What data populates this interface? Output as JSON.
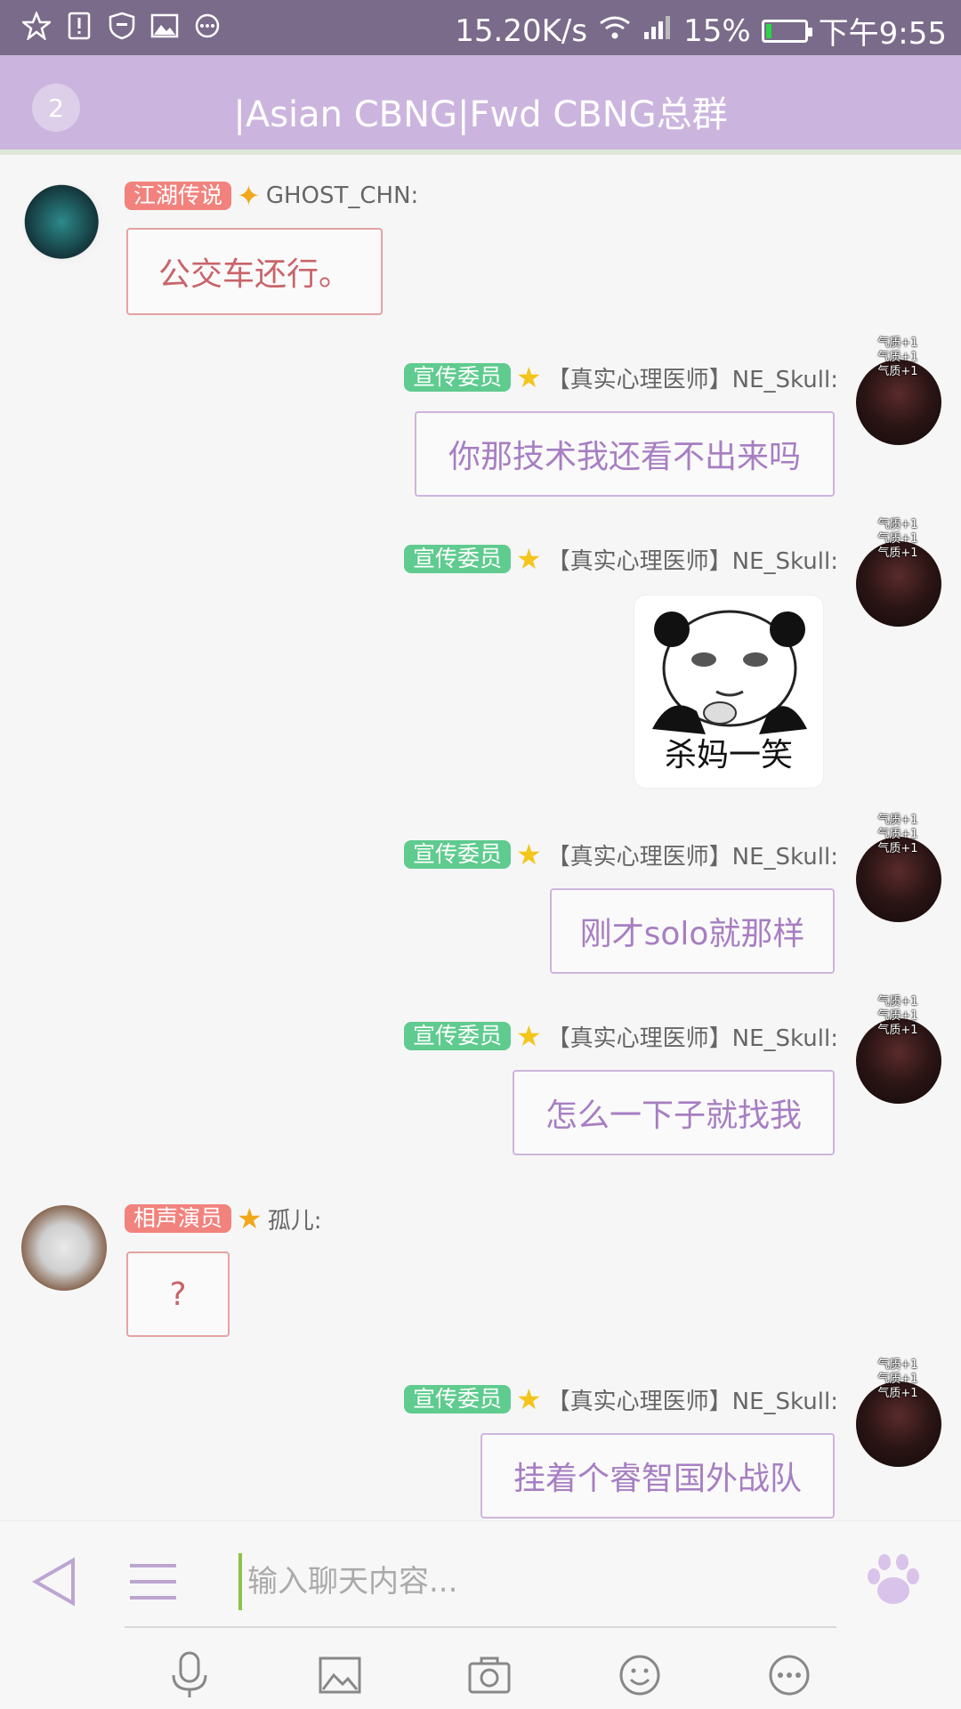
{
  "status_bar": {
    "net_speed": "15.20K/s",
    "battery": "15%",
    "battery_level": 0.15,
    "time": "下午9:55",
    "icons": [
      "star-z-icon",
      "alert-icon",
      "shield-icon",
      "image-icon",
      "more-icon",
      "wifi-icon",
      "signal-icon",
      "battery-icon"
    ]
  },
  "header": {
    "badge": "2",
    "title": "|Asian CBNG|Fwd CBNG总群"
  },
  "avatar_frame_text": [
    "气质+1",
    "气质+1",
    "气质+1"
  ],
  "messages": [
    {
      "side": "left",
      "tag": "江湖传说",
      "sender": "GHOST_CHN:",
      "text": "公交车还行。"
    },
    {
      "side": "right",
      "tag": "宣传委员",
      "sender": "【真实心理医师】NE_Skull:",
      "text": "你那技术我还看不出来吗"
    },
    {
      "side": "right",
      "tag": "宣传委员",
      "sender": "【真实心理医师】NE_Skull:",
      "sticker_caption": "杀妈一笑"
    },
    {
      "side": "right",
      "tag": "宣传委员",
      "sender": "【真实心理医师】NE_Skull:",
      "text": "刚才solo就那样"
    },
    {
      "side": "right",
      "tag": "宣传委员",
      "sender": "【真实心理医师】NE_Skull:",
      "text": "怎么一下子就找我"
    },
    {
      "side": "left",
      "tag": "相声演员",
      "sender": "孤儿:",
      "text": "?"
    },
    {
      "side": "right",
      "tag": "宣传委员",
      "sender": "【真实心理医师】NE_Skull:",
      "text": "挂着个睿智国外战队"
    }
  ],
  "input": {
    "placeholder": "输入聊天内容..."
  },
  "colors": {
    "header_bg": "#cbb5de",
    "status_bg": "#7a6b8a",
    "tag_pink": "#f2827d",
    "tag_green": "#5fcb8f",
    "bubble_left_text": "#c9646a",
    "bubble_right_text": "#a77ec2"
  }
}
